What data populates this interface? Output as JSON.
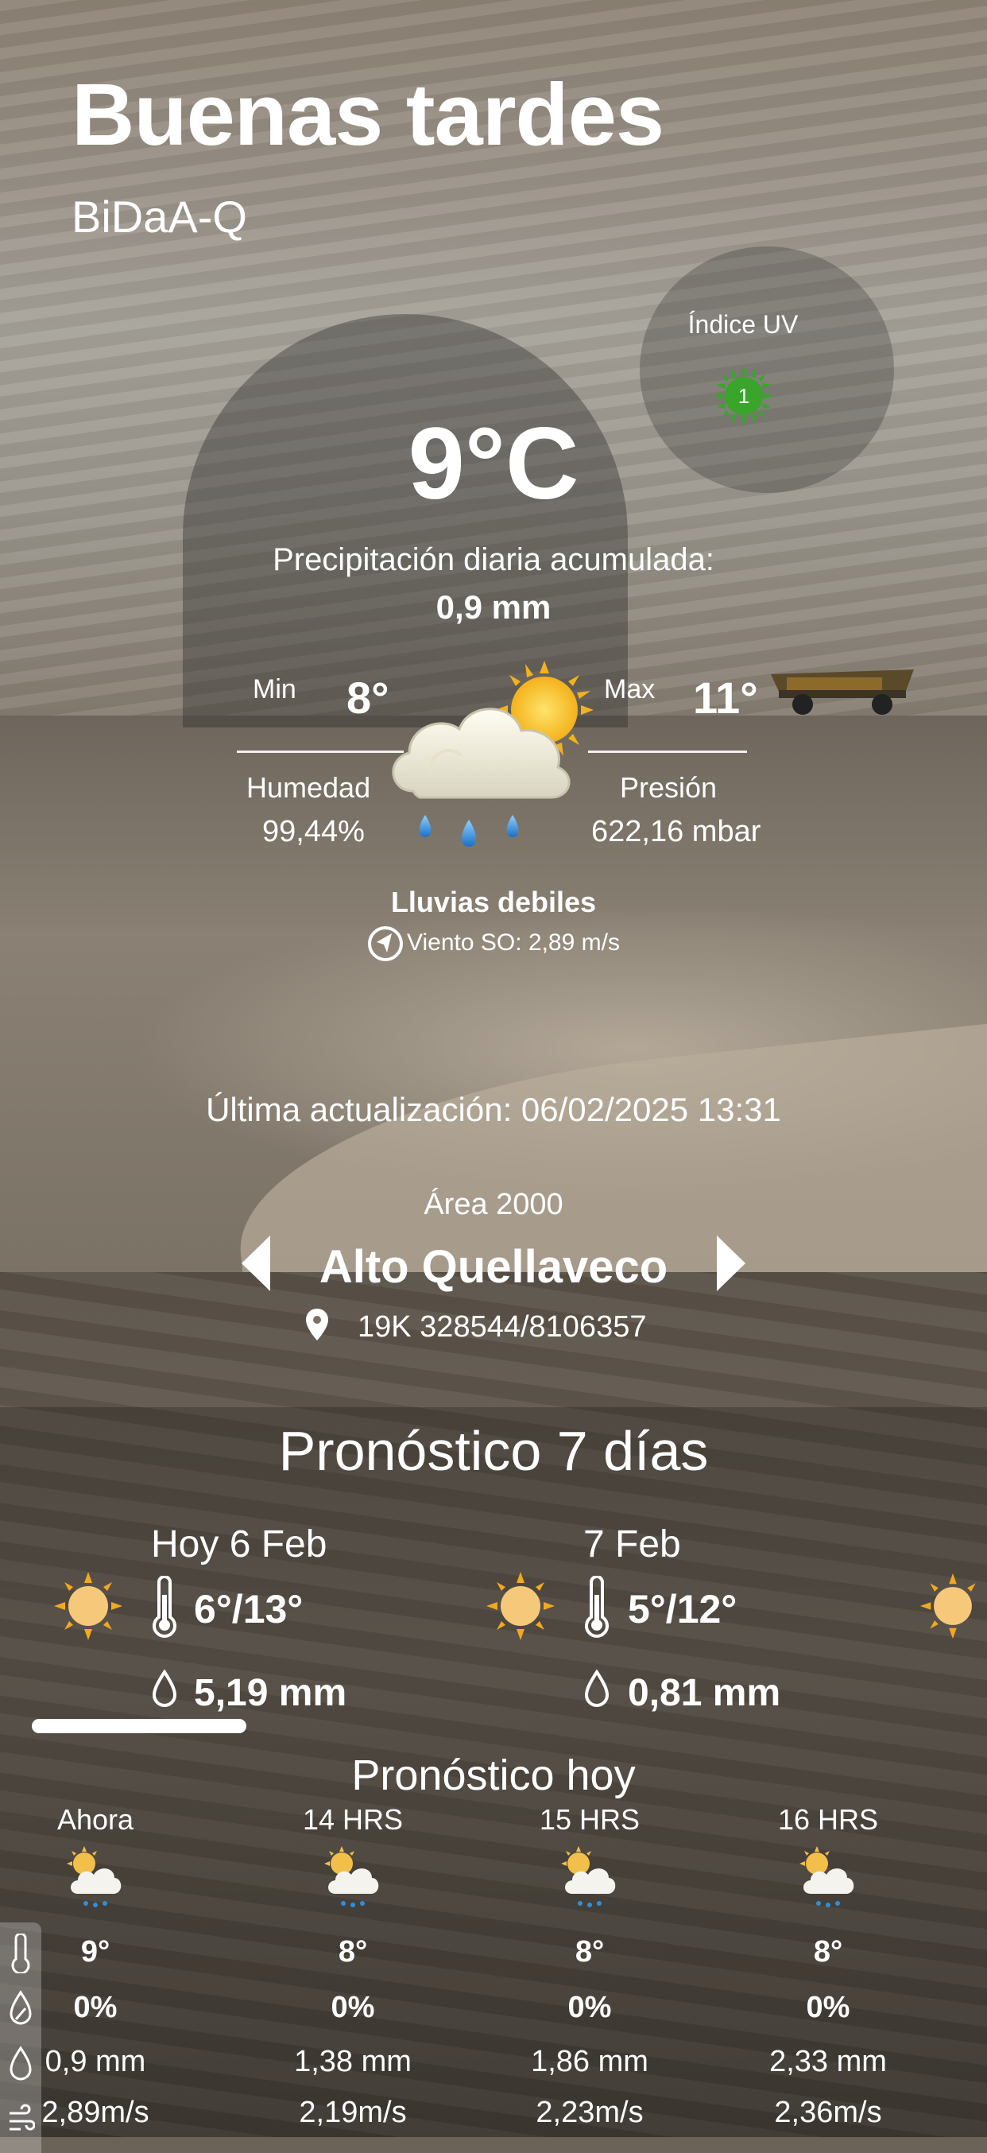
{
  "header": {
    "greeting": "Buenas tardes",
    "subtitle": "BiDaA-Q"
  },
  "uv": {
    "label": "Índice UV",
    "value": "1",
    "color": "#3aa52b"
  },
  "current": {
    "temperature": "9°C",
    "precip_label": "Precipitación diaria acumulada:",
    "precip_value": "0,9 mm",
    "min_label": "Min",
    "min_value": "8°",
    "max_label": "Max",
    "max_value": "11°",
    "humidity_label": "Humedad",
    "humidity_value": "99,44%",
    "pressure_label": "Presión",
    "pressure_value": "622,16 mbar",
    "condition": "Lluvias debiles",
    "wind": "Viento SO: 2,89 m/s",
    "icon": "sun-cloud-rain-icon"
  },
  "updated": "Última actualización: 06/02/2025 13:31",
  "location": {
    "area": "Área 2000",
    "site": "Alto Quellaveco",
    "coords": "19K 328544/8106357"
  },
  "forecast": {
    "title": "Pronóstico 7 días",
    "days": [
      {
        "date": "Hoy 6 Feb",
        "temps": "6°/13°",
        "rain": "5,19 mm",
        "icon": "sun-icon"
      },
      {
        "date": "7 Feb",
        "temps": "5°/12°",
        "rain": "0,81 mm",
        "icon": "sun-icon"
      }
    ]
  },
  "today": {
    "title": "Pronóstico hoy",
    "hours": [
      {
        "hour": "Ahora",
        "temp": "9°",
        "prob": "0%",
        "mm": "0,9 mm",
        "wind": "2,89m/s"
      },
      {
        "hour": "14 HRS",
        "temp": "8°",
        "prob": "0%",
        "mm": "1,38 mm",
        "wind": "2,19m/s"
      },
      {
        "hour": "15 HRS",
        "temp": "8°",
        "prob": "0%",
        "mm": "1,86 mm",
        "wind": "2,23m/s"
      },
      {
        "hour": "16 HRS",
        "temp": "8°",
        "prob": "0%",
        "mm": "2,33 mm",
        "wind": "2,36m/s"
      }
    ]
  },
  "colors": {
    "sun": "#f2bf4a",
    "sun_core": "#f6c97a",
    "rain_drop": "#2f8fd8"
  }
}
